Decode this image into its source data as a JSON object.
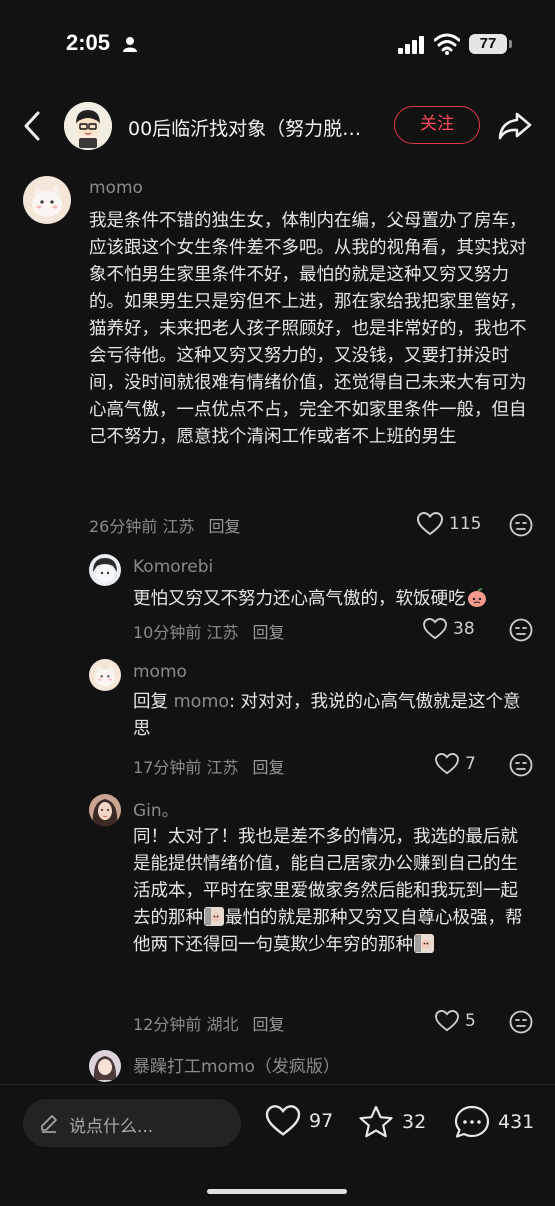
{
  "status": {
    "time": "2:05",
    "battery": "77"
  },
  "header": {
    "title": "00后临沂找对象（努力脱…",
    "follow_label": "关注"
  },
  "comments": [
    {
      "author": "momo",
      "text": "我是条件不错的独生女，体制内在编，父母置办了房车，应该跟这个女生条件差不多吧。从我的视角看，其实找对象不怕男生家里条件不好，最怕的就是这种又穷又努力的。如果男生只是穷但不上进，那在家给我把家里管好，猫养好，未来把老人孩子照顾好，也是非常好的，我也不会亏待他。这种又穷又努力的，又没钱，又要打拼没时间，没时间就很难有情绪价值，还觉得自己未来大有可为心高气傲，一点优点不占，完全不如家里条件一般，但自己不努力，愿意找个清闲工作或者不上班的男生",
      "meta": "26分钟前 江苏",
      "reply_label": "回复",
      "likes": "115"
    },
    {
      "author": "Komorebi",
      "text": "更怕又穷又不努力还心高气傲的，软饭硬吃",
      "meta": "10分钟前 江苏",
      "reply_label": "回复",
      "likes": "38"
    },
    {
      "author": "momo",
      "reply_prefix": "回复 ",
      "mention": "momo",
      "text": ": 对对对，我说的心高气傲就是这个意思",
      "meta": "17分钟前 江苏",
      "reply_label": "回复",
      "likes": "7"
    },
    {
      "author": "Gin。",
      "text_part1": "同！太对了！我也是差不多的情况，我选的最后就是能提供情绪价值，能自己居家办公赚到自己的生活成本，平时在家里爱做家务然后能和我玩到一起去的那种",
      "text_part2": "最怕的就是那种又穷又自尊心极强，帮他两下还得回一句莫欺少年穷的那种",
      "meta": "12分钟前 湖北",
      "reply_label": "回复",
      "likes": "5"
    },
    {
      "author": "暴躁打工momo（发疯版）"
    }
  ],
  "bottom": {
    "placeholder": "说点什么...",
    "likes": "97",
    "stars": "32",
    "comments": "431"
  },
  "colors": {
    "accent": "#ff4a5a",
    "background": "#121212"
  }
}
